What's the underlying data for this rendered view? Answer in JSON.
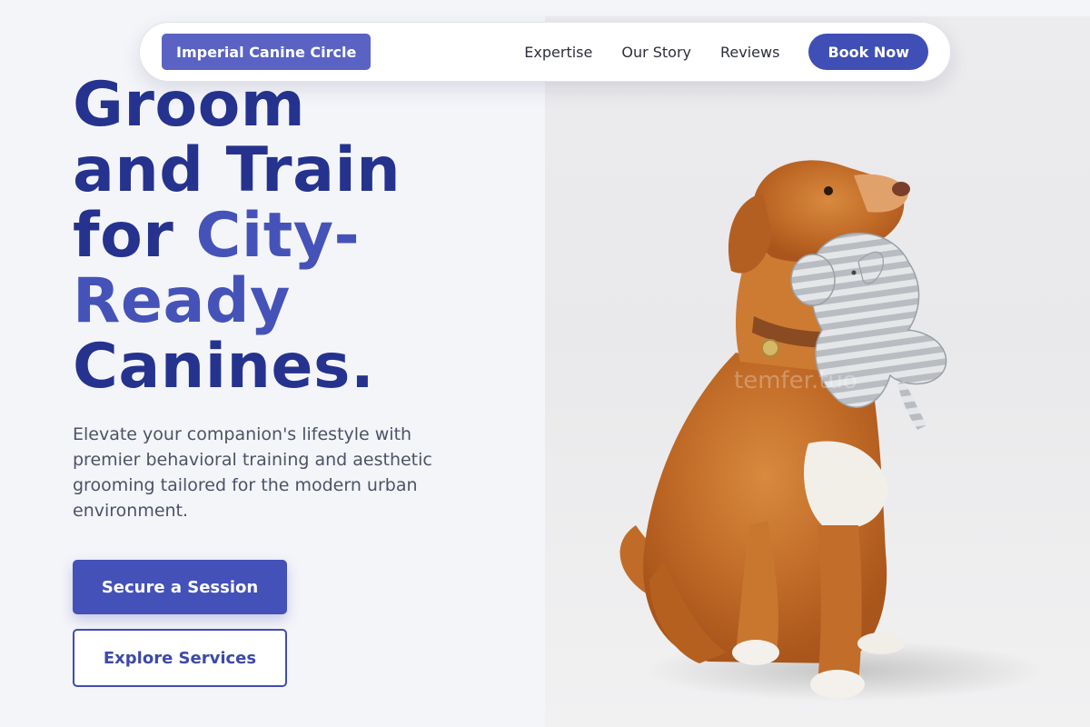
{
  "nav": {
    "brand": "Imperial Canine Circle",
    "links": [
      "Expertise",
      "Our Story",
      "Reviews"
    ],
    "cta": "Book Now"
  },
  "hero": {
    "title_line1": "Groom",
    "title_line2": "and Train",
    "title_line3_plain": "for ",
    "title_line3_accent": "City-",
    "title_line4_accent": "Ready",
    "title_line5": "Canines.",
    "subtitle": "Elevate your companion's lifestyle with premier behavioral training and aesthetic grooming tailored for the modern urban environment.",
    "primary_button": "Secure a Session",
    "secondary_button": "Explore Services",
    "image": {
      "subject": "dog-with-plush-toy-photo"
    }
  },
  "colors": {
    "brand_badge": "#5a63c4",
    "primary": "#3f4fb5",
    "heading": "#25338f",
    "heading_accent": "#4553b9",
    "body_text": "#4c5366",
    "page_bg": "#f4f5f9"
  }
}
